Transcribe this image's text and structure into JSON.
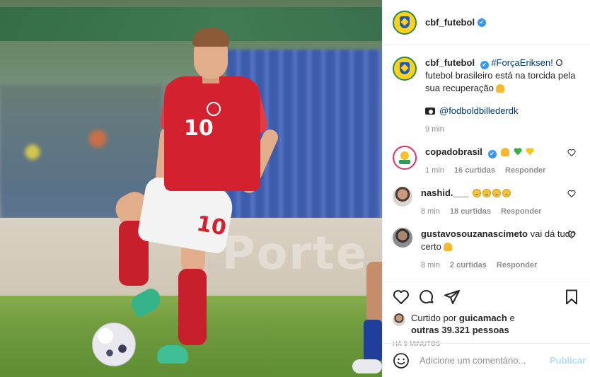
{
  "photo": {
    "shirt_number": "10",
    "shorts_number": "10",
    "board_text": "Porte"
  },
  "header": {
    "username": "cbf_futebol",
    "verified": "✔"
  },
  "caption": {
    "username": "cbf_futebol",
    "verified": "✔",
    "hashtag": "#ForçaEriksen!",
    "text": " O futebol brasileiro está na torcida pela sua recuperação",
    "photo_credit": "@fodboldbillederdk",
    "time": "9 min"
  },
  "comments": [
    {
      "username": "copadobrasil",
      "verified": "✔",
      "text": "",
      "time": "1 min",
      "likes": "16 curtidas",
      "reply": "Responder"
    },
    {
      "username": "nashid.___",
      "text": "",
      "time": "8 min",
      "likes": "18 curtidas",
      "reply": "Responder"
    },
    {
      "username": "gustavosouzanascimeto",
      "text": " vai dá tudo certo",
      "time": "8 min",
      "likes": "2 curtidas",
      "reply": "Responder"
    }
  ],
  "likes": {
    "prefix": "Curtido por ",
    "user": "guicamach",
    "middle": " e ",
    "others": "outras 39.321 pessoas"
  },
  "timestamp": "HÁ 9 MINUTOS",
  "add_comment": {
    "placeholder": "Adicione um comentário...",
    "publish": "Publicar"
  },
  "colors": {
    "accent": "#3897f0",
    "link": "#00376b",
    "publish_disabled": "#b2dffc",
    "muted": "#8e8e8e"
  }
}
